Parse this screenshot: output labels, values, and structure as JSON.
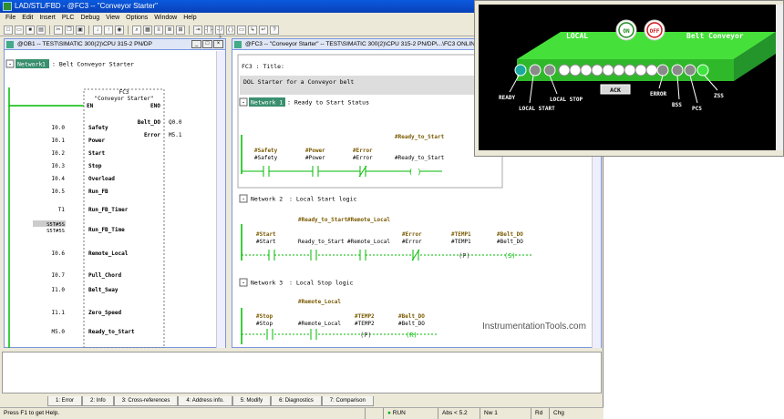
{
  "window": {
    "title": "LAD/STL/FBD - @FC3 -- \"Conveyor Starter\""
  },
  "menu": [
    "File",
    "Edit",
    "Insert",
    "PLC",
    "Debug",
    "View",
    "Options",
    "Window",
    "Help"
  ],
  "left_window": {
    "title": "@OB1 -- TEST\\SIMATIC 300(2)\\CPU 315-2 PN/DP",
    "network_label": "Network",
    "network_num": "1",
    "network_title": ": Belt Conveyor Starter",
    "block": {
      "name": "FC3",
      "comment": "\"Conveyor Starter\"",
      "en": "EN",
      "eno": "ENO"
    },
    "inputs": [
      {
        "addr": "I0.0",
        "pin": "Safety"
      },
      {
        "addr": "I0.1",
        "pin": "Power"
      },
      {
        "addr": "I0.2",
        "pin": "Start"
      },
      {
        "addr": "I0.3",
        "pin": "Stop"
      },
      {
        "addr": "I0.4",
        "pin": "Overload"
      },
      {
        "addr": "I0.5",
        "pin": "Run_FB"
      },
      {
        "addr": "T1",
        "pin": "Run_FB_Timer"
      },
      {
        "addr": "S5T#5S",
        "pin": "Run_FB_Time",
        "addr2": "S5T#5S"
      },
      {
        "addr": "I0.6",
        "pin": "Remote_Local"
      },
      {
        "addr": "I0.7",
        "pin": "Pull_Chord"
      },
      {
        "addr": "I1.0",
        "pin": "Belt_Sway"
      },
      {
        "addr": "I1.1",
        "pin": "Zero_Speed"
      },
      {
        "addr": "M5.0",
        "pin": "Ready_to_Start"
      }
    ],
    "outputs": [
      {
        "pin": "Belt_DO",
        "addr": "Q0.0"
      },
      {
        "pin": "Error",
        "addr": "M5.1"
      }
    ]
  },
  "right_window": {
    "title": "@FC3 -- \"Conveyor Starter\" -- TEST\\SIMATIC 300(2)\\CPU 315-2 PN/DP\\...\\FC3  ONLINE",
    "block_title": "FC3 : Title:",
    "block_comment": "DOL Starter for a Conveyor belt",
    "networks": [
      {
        "label": "Network 1",
        "title": ": Ready to Start Status",
        "contacts": [
          {
            "sym": "#Safety",
            "name": "#Safety",
            "type": "NO"
          },
          {
            "sym": "#Power",
            "name": "#Power",
            "type": "NO"
          },
          {
            "sym": "#Error",
            "name": "#Error",
            "type": "NC"
          },
          {
            "sym": "#Ready_to_Start",
            "name": "#Ready_to_Start",
            "type": "COIL"
          }
        ]
      },
      {
        "label": "Network 2",
        "title": ": Local Start logic",
        "contacts": [
          {
            "sym": "#Start",
            "name": "#Start",
            "type": "NO"
          },
          {
            "sym": "#Ready_to_Start",
            "name": "Ready_to_Start",
            "type": "NO"
          },
          {
            "sym": "#Remote_Local",
            "name": "#Remote_Local",
            "type": "NO"
          },
          {
            "sym": "#Error",
            "name": "#Error",
            "type": "NC"
          },
          {
            "sym": "#TEMP1",
            "name": "#TEMP1",
            "type": "P"
          },
          {
            "sym": "#Belt_DO",
            "name": "#Belt_DO",
            "type": "S"
          }
        ]
      },
      {
        "label": "Network 3",
        "title": ": Local Stop logic",
        "contacts": [
          {
            "sym": "#Stop",
            "name": "#Stop",
            "type": "NO"
          },
          {
            "sym": "#Remote_Local",
            "name": "#Remote_Local",
            "type": "NO"
          },
          {
            "sym": "#TEMP2",
            "name": "#TEMP2",
            "type": "P"
          },
          {
            "sym": "#Belt_DO",
            "name": "#Belt_DO",
            "type": "R"
          }
        ]
      }
    ]
  },
  "tabs": [
    "1: Error",
    "2: Info",
    "3: Cross-references",
    "4: Address info.",
    "5: Modify",
    "6: Diagnostics",
    "7: Comparison"
  ],
  "status": {
    "help": "Press F1 to get Help.",
    "mode": "RUN",
    "abs": "Abs < 5.2",
    "nw": "Nw 1",
    "rd": "Rd",
    "chg": "Chg"
  },
  "hmi": {
    "local_label": "LOCAL",
    "on_label": "ON",
    "off_label": "OFF",
    "title": "Belt Conveyor",
    "ack_label": "ACK",
    "indicators": [
      "READY",
      "LOCAL START",
      "LOCAL STOP",
      "ERROR",
      "BSS",
      "PCS",
      "ZSS"
    ],
    "colors": {
      "belt": "#3ecf2e",
      "ready": "#1aa9a0",
      "zss": "#3ee53e",
      "indicator_off": "#8a8a8a",
      "on_button": "#1e8a1e",
      "off_button": "#d01818"
    }
  },
  "watermark": "InstrumentationTools.com"
}
